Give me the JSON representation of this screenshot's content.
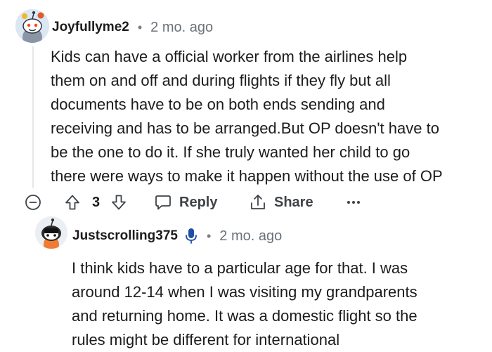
{
  "comments": [
    {
      "username": "Joyfullyme2",
      "separator": "•",
      "timestamp": "2 mo. ago",
      "body_lines": [
        "Kids can have a official worker from the airlines help",
        "them on and off and during flights if they fly but all",
        "documents have to be on both ends sending and",
        "receiving and has to be arranged.But OP doesn't have to",
        "be the one to do it. If she truly wanted her child to go",
        "there were ways to make it happen without the use of OP"
      ],
      "actions": {
        "score": "3",
        "reply_label": "Reply",
        "share_label": "Share",
        "more_label": "•••"
      }
    },
    {
      "username": "Justscrolling375",
      "separator": "•",
      "timestamp": "2 mo. ago",
      "body_lines": [
        "I think kids have to a particular age for that. I was",
        "around 12-14 when I was visiting my grandparents",
        "and returning home. It was a domestic flight so the",
        "rules might be different for international"
      ]
    }
  ],
  "icons": {
    "collapse": "minus-circle-icon",
    "upvote": "arrow-up-icon",
    "downvote": "arrow-down-icon",
    "reply": "speech-bubble-icon",
    "share": "share-icon",
    "more": "more-icon",
    "mic": "microphone-icon"
  },
  "colors": {
    "text": "#1c1c1c",
    "meta": "#6b7178",
    "icon": "#3f4348",
    "mic": "#1f4fa5",
    "thread_line": "#e5e7eb"
  }
}
